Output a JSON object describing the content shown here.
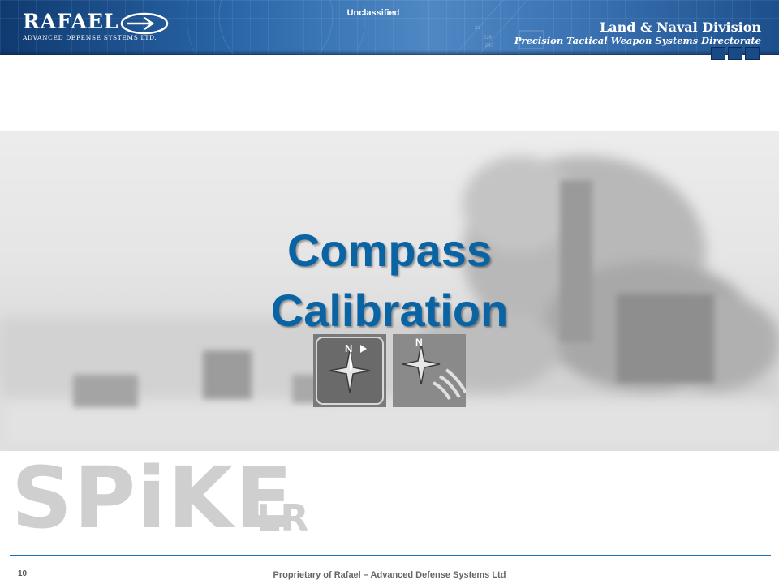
{
  "header": {
    "logo_text": "RAFAEL",
    "logo_subtitle": "ADVANCED DEFENSE SYSTEMS LTD.",
    "classification": "Unclassified",
    "division": "Land & Naval Division",
    "directorate": "Precision Tactical Weapon Systems Directorate"
  },
  "slide": {
    "title_line1": "Compass",
    "title_line2": "Calibration",
    "icons": [
      {
        "name": "compass-icon",
        "label": "N"
      },
      {
        "name": "compass-calibration-icon",
        "label": "N"
      }
    ]
  },
  "branding": {
    "product": "SPiKE",
    "variant": "LR"
  },
  "footer": {
    "page_number": "10",
    "proprietary": "Proprietary of Rafael – Advanced Defense Systems Ltd"
  },
  "colors": {
    "header_blue": "#2a66a8",
    "title_blue": "#0a64a4",
    "rule_blue": "#1f6fb3",
    "watermark_gray": "#cfcfcf"
  }
}
